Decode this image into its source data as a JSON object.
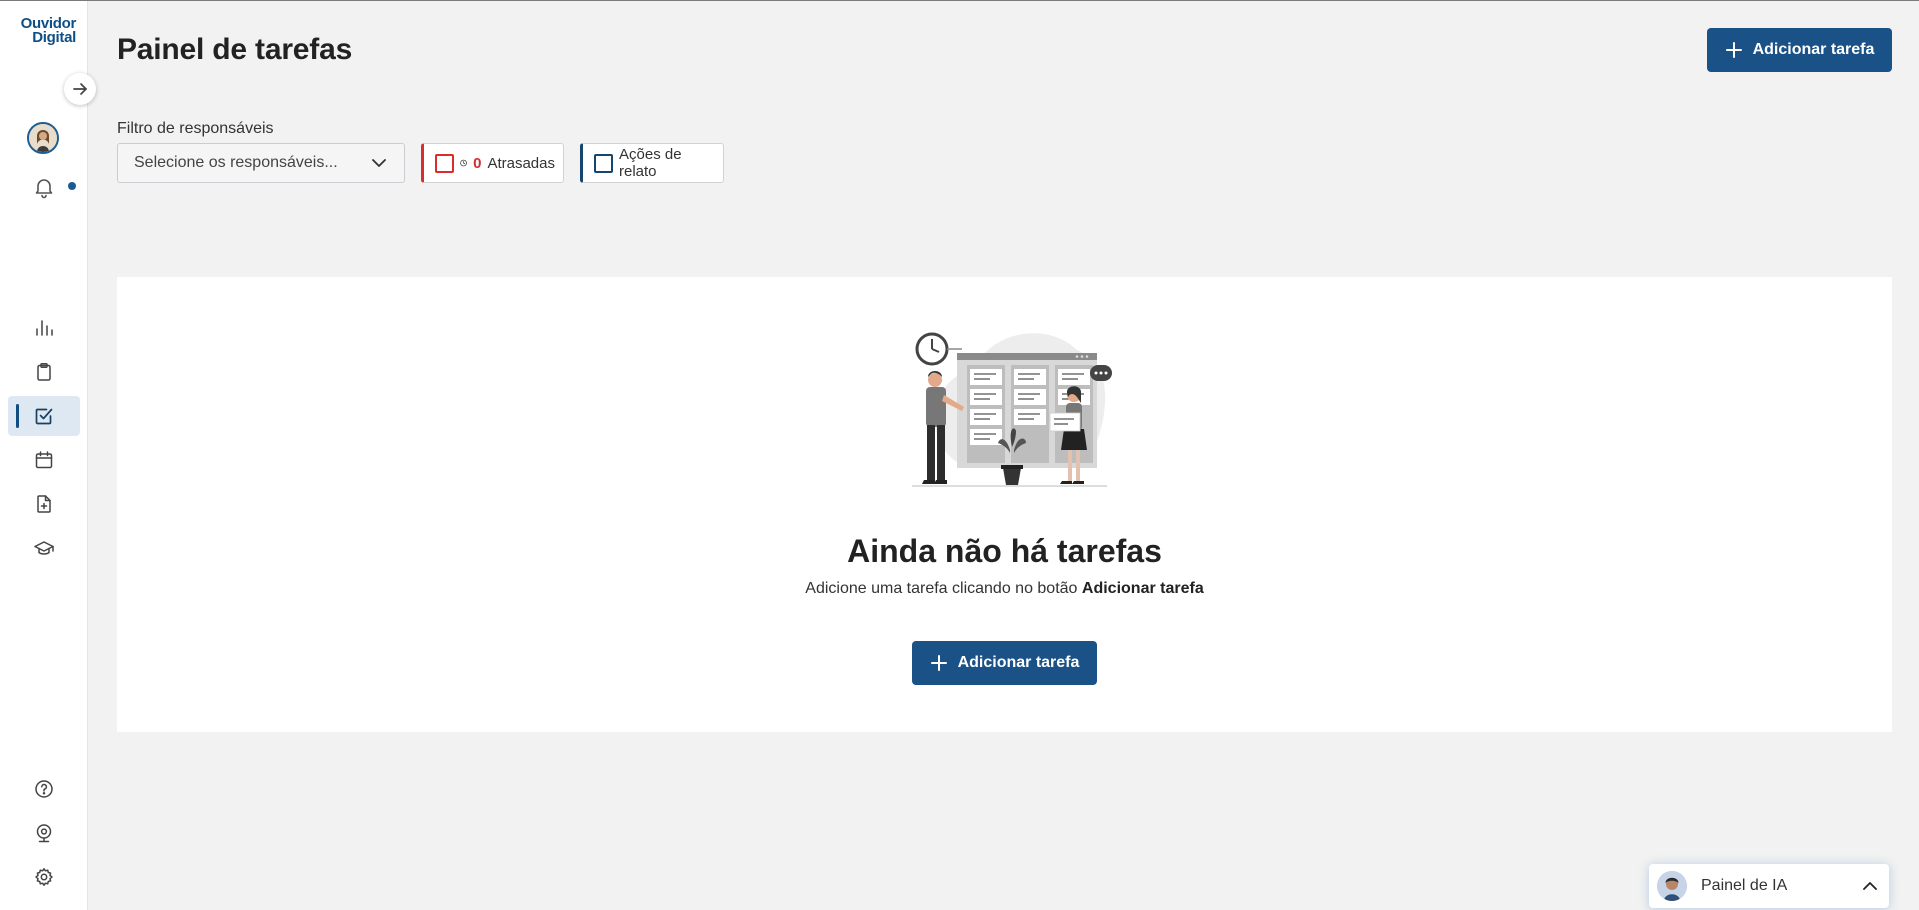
{
  "app": {
    "logo_line1": "Ouvidor",
    "logo_line2": "Digital"
  },
  "sidebar": {
    "nav_items": [
      {
        "name": "dashboard",
        "icon": "bar-chart-icon",
        "active": false
      },
      {
        "name": "reports",
        "icon": "clipboard-icon",
        "active": false
      },
      {
        "name": "tasks",
        "icon": "checkbox-icon",
        "active": true
      },
      {
        "name": "calendar",
        "icon": "calendar-icon",
        "active": false
      },
      {
        "name": "documents",
        "icon": "file-plus-icon",
        "active": false
      },
      {
        "name": "training",
        "icon": "graduation-cap-icon",
        "active": false
      }
    ],
    "bottom_items": [
      {
        "name": "help",
        "icon": "help-circle-icon"
      },
      {
        "name": "webcam",
        "icon": "webcam-icon"
      },
      {
        "name": "settings",
        "icon": "gear-icon"
      }
    ]
  },
  "header": {
    "title": "Painel de tarefas",
    "add_button_label": "Adicionar tarefa"
  },
  "filters": {
    "responsibles_label": "Filtro de responsáveis",
    "responsibles_placeholder": "Selecione os responsáveis...",
    "late_count": "0",
    "late_label": "Atrasadas",
    "late_checked": false,
    "actions_label": "Ações de relato",
    "actions_checked": false
  },
  "empty_state": {
    "title": "Ainda não há tarefas",
    "subtitle_prefix": "Adicione uma tarefa clicando no botão",
    "subtitle_bold": "Adicionar tarefa",
    "button_label": "Adicionar tarefa"
  },
  "ai_panel": {
    "label": "Painel de IA"
  },
  "colors": {
    "primary": "#1a5187",
    "danger": "#d62d2d",
    "nav_active_bg": "#dde8f3",
    "background": "#f1f2f1"
  }
}
